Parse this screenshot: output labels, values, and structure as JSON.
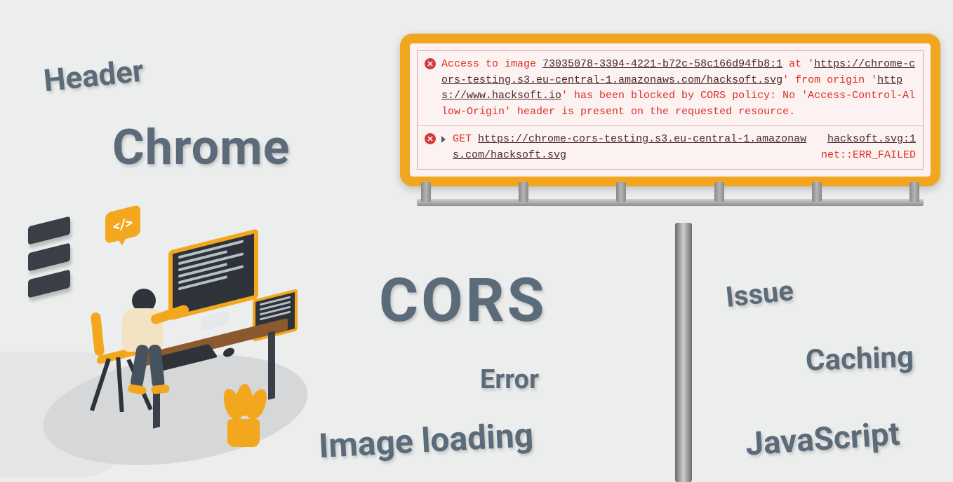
{
  "words": {
    "header": "Header",
    "chrome": "Chrome",
    "cors": "CORS",
    "issue": "Issue",
    "caching": "Caching",
    "error": "Error",
    "imageloading": "Image loading",
    "javascript": "JavaScript"
  },
  "console": {
    "error1": {
      "prefix": "Access to image ",
      "imageRef": "73035078-3394-4221-b72c-58c166d94fb8:1",
      "mid1": " at '",
      "url1": "https://chrome-cors-testing.s3.eu-central-1.amazonaws.com/hacksoft.svg",
      "mid2": "' from origin '",
      "url2": "https://www.hacksoft.io",
      "tail": "' has been blocked by CORS policy: No 'Access-Control-Allow-Origin' header is present on the requested resource."
    },
    "error2": {
      "method": "GET",
      "url": "https://chrome-cors-testing.s3.eu-central-1.amazonaws.com/hacksoft.svg",
      "sourceFile": "hacksoft.svg:1",
      "netError": "net::ERR_FAILED"
    }
  },
  "illustration": {
    "bubbleIcon": "</>"
  }
}
